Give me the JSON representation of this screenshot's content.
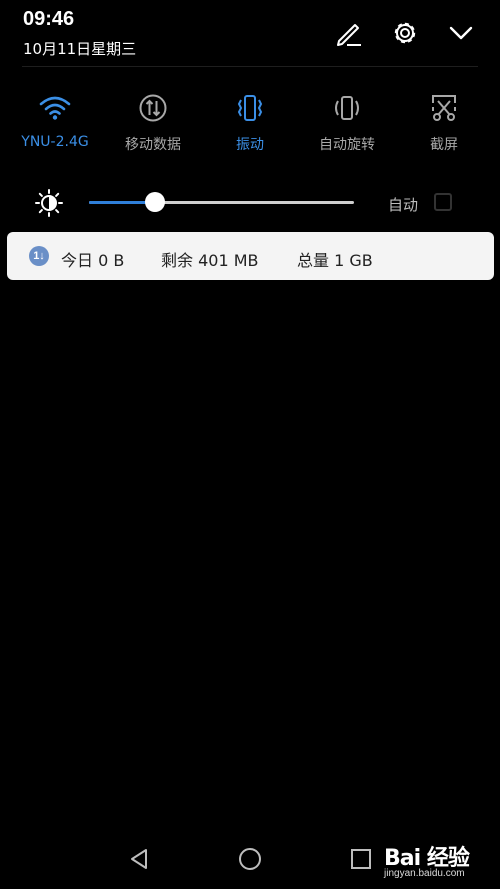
{
  "status": {
    "time": "09:46",
    "date": "10月11日星期三"
  },
  "header_icons": [
    "edit-icon",
    "gear-icon",
    "chevron-down-icon"
  ],
  "tiles": [
    {
      "label": "YNU-2.4G",
      "icon": "wifi-icon",
      "active": true
    },
    {
      "label": "移动数据",
      "icon": "mobile-data-icon",
      "active": false
    },
    {
      "label": "振动",
      "icon": "vibrate-icon",
      "active": true
    },
    {
      "label": "自动旋转",
      "icon": "auto-rotate-icon",
      "active": false
    },
    {
      "label": "截屏",
      "icon": "screenshot-icon",
      "active": false
    }
  ],
  "brightness": {
    "level": 0.25,
    "auto_label": "自动",
    "auto_checked": false
  },
  "data_usage": {
    "today": "今日 0 B",
    "remaining": "剩余 401 MB",
    "total": "总量 1 GB",
    "badge": "1↓"
  },
  "navigation": [
    "back-icon",
    "home-icon",
    "recents-icon"
  ],
  "watermark": {
    "brand": "Bai 经验",
    "url": "jingyan.baidu.com"
  },
  "colors": {
    "accent": "#3b8fe6",
    "inactive": "#a8a8a8",
    "background": "#000000",
    "card": "#f4f4f4"
  }
}
